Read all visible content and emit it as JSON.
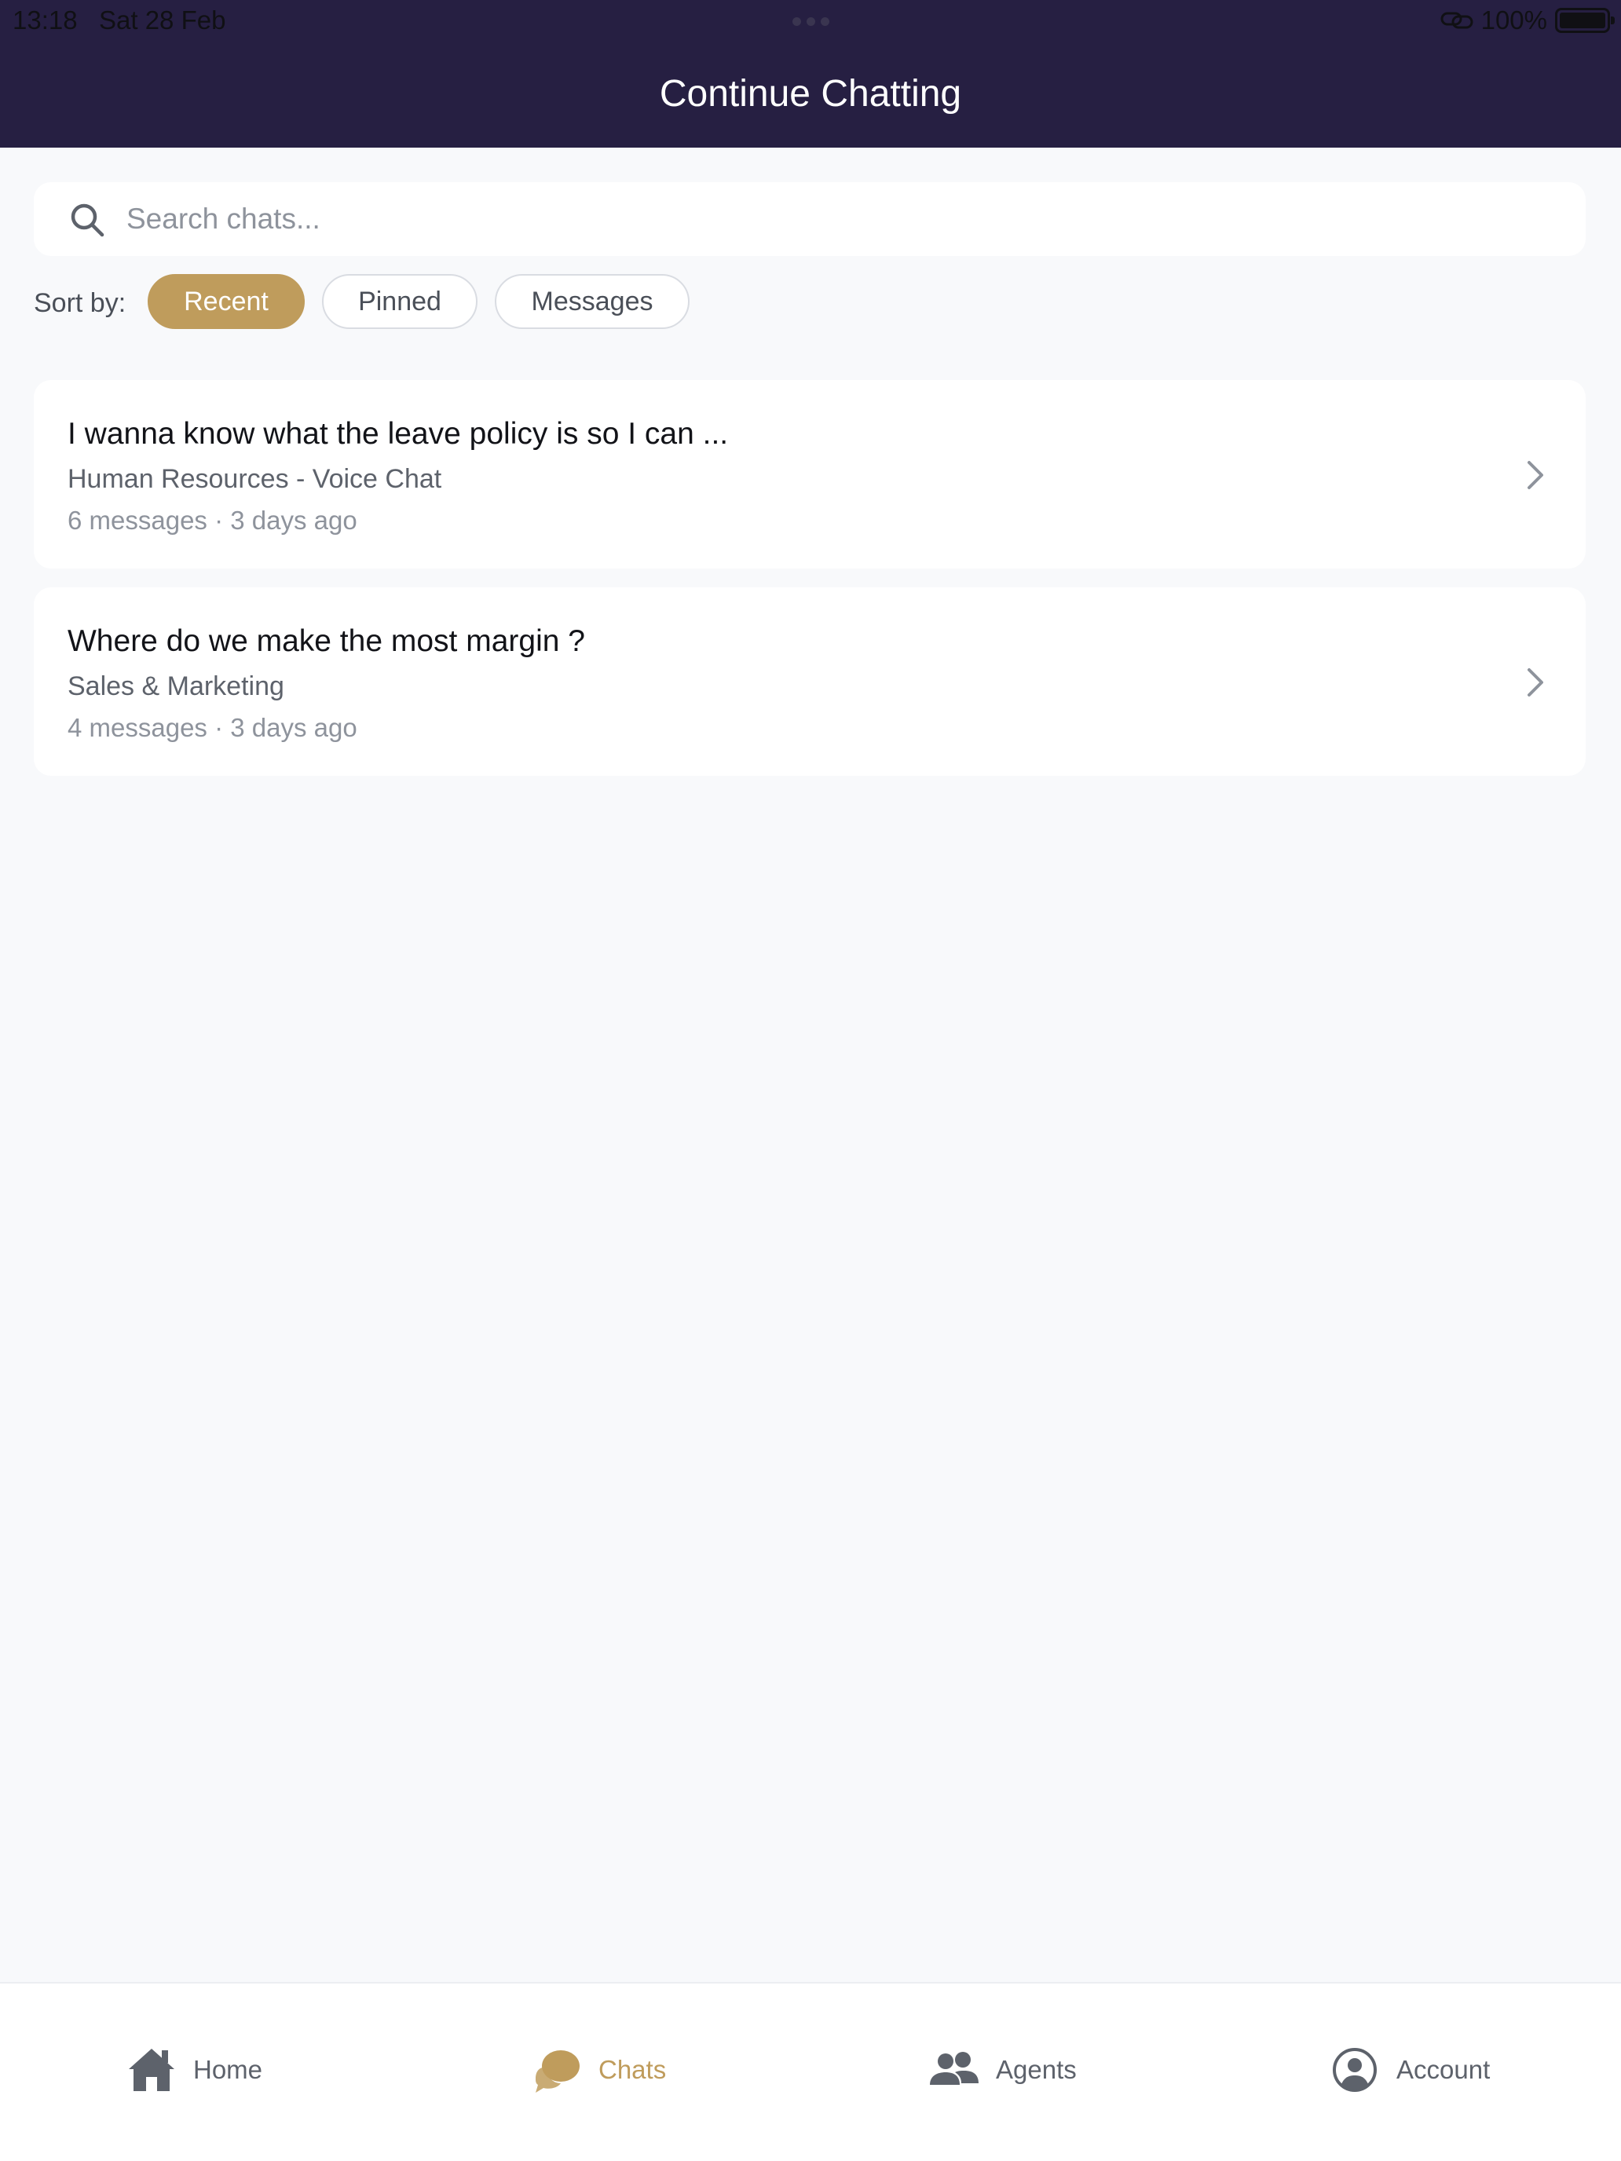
{
  "status_bar": {
    "time": "13:18",
    "date": "Sat 28 Feb",
    "battery": "100%"
  },
  "header": {
    "title": "Continue Chatting"
  },
  "search": {
    "placeholder": "Search chats...",
    "value": ""
  },
  "sort": {
    "label": "Sort by:",
    "options": [
      "Recent",
      "Pinned",
      "Messages"
    ],
    "selected": "Recent"
  },
  "chats": [
    {
      "title": "I wanna know what the leave policy is so I can ...",
      "agent": "Human Resources - Voice Chat",
      "meta": "6 messages · 3 days ago"
    },
    {
      "title": "Where do we make the most margin ?",
      "agent": "Sales & Marketing",
      "meta": "4 messages · 3 days ago"
    }
  ],
  "tabbar": {
    "items": [
      {
        "label": "Home",
        "icon": "home-icon"
      },
      {
        "label": "Chats",
        "icon": "chat-bubbles-icon"
      },
      {
        "label": "Agents",
        "icon": "users-icon"
      },
      {
        "label": "Account",
        "icon": "user-circle-icon"
      }
    ],
    "active": "Chats"
  },
  "colors": {
    "header_bg": "#261f42",
    "accent": "#bf9c5c",
    "page_bg": "#f8f9fb",
    "icon_gray": "#5d626b"
  }
}
